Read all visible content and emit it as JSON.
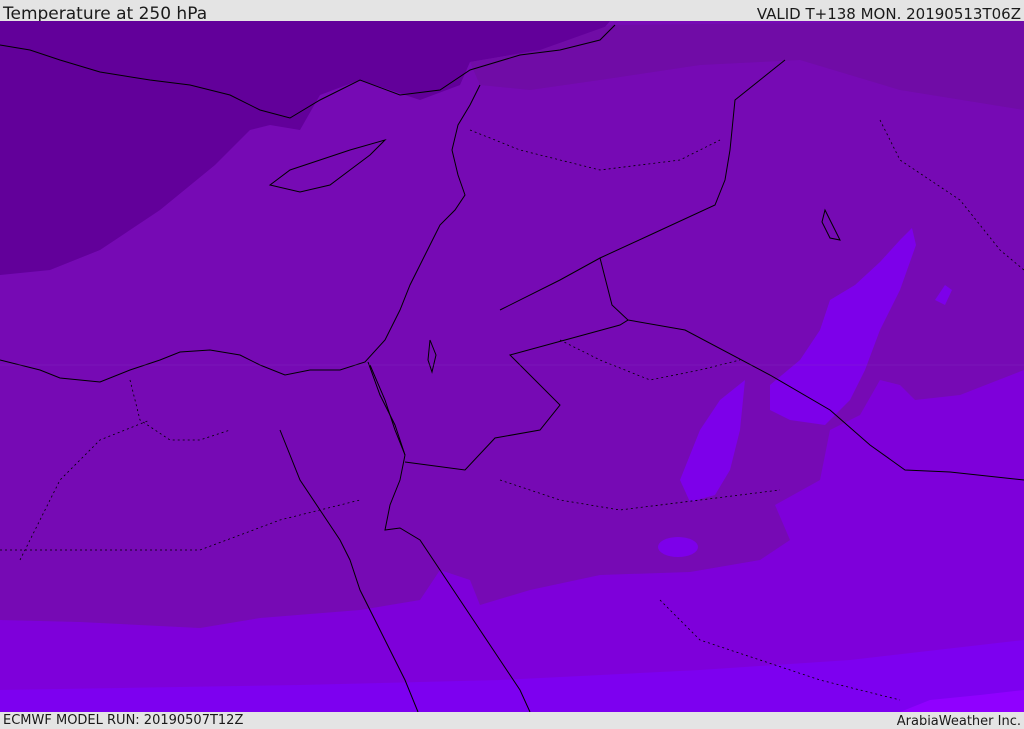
{
  "header": {
    "title": "Temperature at 250 hPa",
    "valid_time": "VALID T+138 MON. 20190513T06Z"
  },
  "footer": {
    "model_run": "ECMWF MODEL RUN: 20190507T12Z",
    "credit": "ArabiaWeather Inc."
  },
  "colors": {
    "coldest": "#62009a",
    "cold": "#700ca6",
    "mid": "#760ab4",
    "warm": "#7e00da",
    "warmest": "#7d00f0",
    "hotspot": "#9000ff",
    "border": "#000000"
  }
}
